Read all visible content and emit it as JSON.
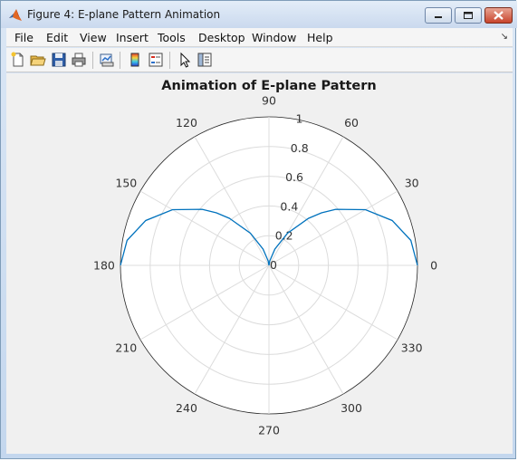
{
  "window": {
    "title": "Figure 4: E-plane Pattern Animation",
    "app_icon": "matlab-logo-icon",
    "buttons": [
      "minimize-icon",
      "maximize-icon",
      "close-icon"
    ]
  },
  "menubar": {
    "items": [
      "File",
      "Edit",
      "View",
      "Insert",
      "Tools",
      "Desktop",
      "Window",
      "Help"
    ],
    "dock_arrow_icon": "dock-arrow-icon"
  },
  "toolbar": {
    "buttons": [
      "new-figure-icon",
      "open-file-icon",
      "save-icon",
      "print-icon",
      "link-plot-icon",
      "insert-colorbar-icon",
      "insert-legend-icon",
      "edit-plot-arrow-icon",
      "show-plot-tools-icon"
    ]
  },
  "chart_data": {
    "type": "polar-line",
    "title": "Animation of E-plane Pattern",
    "angle_ticks_deg": [
      0,
      30,
      60,
      90,
      120,
      150,
      180,
      210,
      240,
      270,
      300,
      330
    ],
    "angle_labels": [
      "0",
      "30",
      "60",
      "90",
      "120",
      "150",
      "180",
      "210",
      "240",
      "270",
      "300",
      "330"
    ],
    "radial_ticks": [
      0,
      0.2,
      0.4,
      0.6,
      0.8,
      1
    ],
    "radial_labels": [
      "0",
      "0.2",
      "0.4",
      "0.6",
      "0.8",
      "1"
    ],
    "rlim": [
      0,
      1
    ],
    "grid": true,
    "series": [
      {
        "color": "#0072bd",
        "function": "r = sin(theta)^2 for theta from 0 to 180 degrees",
        "theta_deg": [
          0,
          10,
          20,
          30,
          40,
          45,
          50,
          60,
          70,
          80,
          90,
          100,
          110,
          120,
          130,
          135,
          140,
          150,
          160,
          170,
          180
        ],
        "r": [
          1.0,
          0.97,
          0.883,
          0.75,
          0.587,
          0.5,
          0.413,
          0.25,
          0.117,
          0.03,
          0.0,
          0.03,
          0.117,
          0.25,
          0.413,
          0.5,
          0.587,
          0.75,
          0.883,
          0.97,
          1.0
        ]
      }
    ]
  }
}
